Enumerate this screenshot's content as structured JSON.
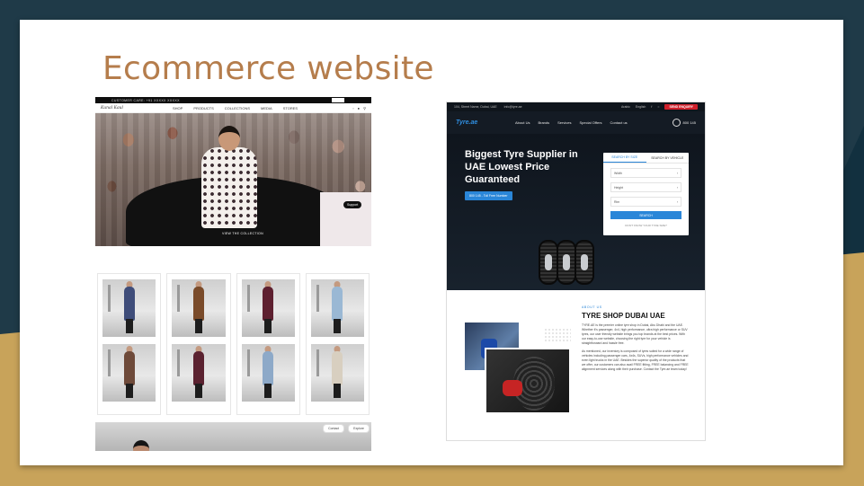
{
  "slide": {
    "title": "Ecommerce website"
  },
  "fashion_site": {
    "promo_text": "CUSTOMER CARE: +91 XXXXX XXXXX",
    "logo": "Kunal Kaul",
    "nav": [
      "SHOP",
      "PRODUCTS",
      "COLLECTIONS",
      "MEDIA",
      "STORES"
    ],
    "hero_button": "VIEW THE COLLECTION",
    "support_label": "Support",
    "product_cards": [
      {
        "colors": [
          "#3f4d7a",
          "#6e4a3a"
        ]
      },
      {
        "colors": [
          "#7a4b2a",
          "#5b2230"
        ]
      },
      {
        "colors": [
          "#5e2030",
          "#8da9c8"
        ]
      },
      {
        "colors": [
          "#9ab8d4",
          "#d8cfc0"
        ]
      }
    ],
    "strip_buttons": [
      "Contact",
      "Explore"
    ]
  },
  "tyre_site": {
    "topbar_address": "104, Street Name, Dubai, UAE",
    "topbar_email": "info@tyre.ae",
    "lang_arabic": "Arabic",
    "lang_english": "English",
    "enquiry_button": "SEND ENQUIRY",
    "logo": "Tyre.ae",
    "nav": [
      "About Us",
      "Brands",
      "Services",
      "Special Offers",
      "Contact us"
    ],
    "phone": "800 145",
    "hero_title": "Biggest Tyre Supplier in UAE Lowest Price Guaranteed",
    "hero_button": "800 145 - Toll Free Number",
    "search": {
      "tab_size": "SEARCH BY SIZE",
      "tab_vehicle": "SEARCH BY VEHICLE",
      "field_width": "Width",
      "field_height": "Height",
      "field_rim": "Rim",
      "button": "SEARCH",
      "help": "DON'T KNOW YOUR TYRE SIZE?"
    },
    "about_kicker": "ABOUT US",
    "about_title": "TYRE SHOP DUBAI UAE",
    "about_p1": "TYRE.AE is the premier online tyre shop in Dubai, Abu Dhabi and the UAE. Whether it's passenger, 4x4, high performance, ultra high performance or SUV tyres, our user friendly website brings you top brands at the best prices. With our easy-to-use website, choosing the right tyre for your vehicle is straightforward and hassle free.",
    "about_p2": "As mentioned, our inventory is composed of tyres suited for a wide range of vehicles including passenger cars, 4x4s, SUVs, high performance vehicles and even light trucks in the UAE. Besides the superior quality of the products that we offer, our customers can also avail FREE fitting, FREE balancing and FREE alignment services along with their purchase. Contact the Tyre.ae team today!"
  }
}
